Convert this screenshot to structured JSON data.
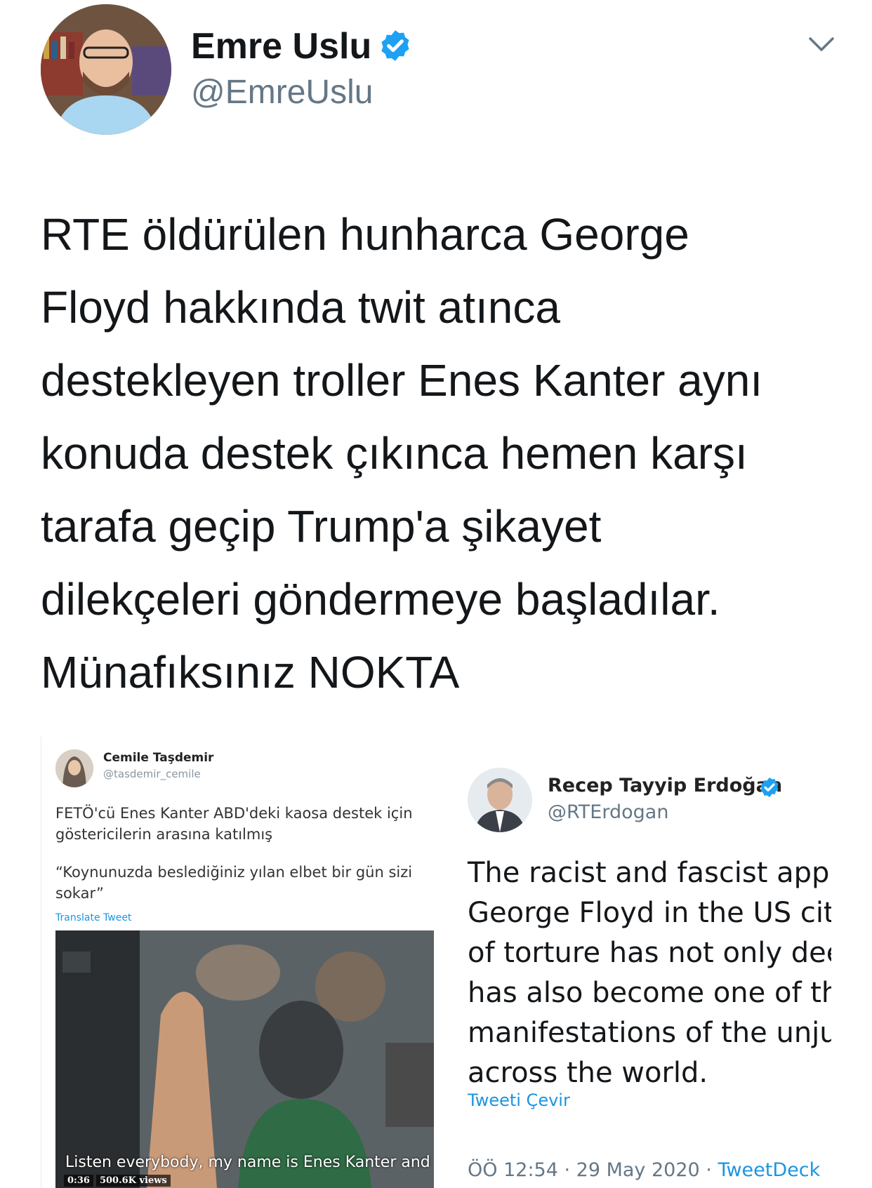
{
  "tweet": {
    "author_name": "Emre Uslu",
    "author_handle": "@EmreUslu",
    "verified_icon": "verified-badge-icon",
    "menu_icon": "chevron-down-icon",
    "text_lines": [
      "RTE öldürülen hunharca George",
      "Floyd hakkında twit atınca",
      "destekleyen troller Enes Kanter aynı",
      "konuda destek çıkınca hemen karşı",
      "tarafa geçip Trump'a şikayet",
      "dilekçeleri göndermeye başladılar.",
      "Münafıksınız NOKTA"
    ]
  },
  "media_left": {
    "author_name": "Cemile Taşdemir",
    "author_handle": "@tasdemir_cemile",
    "text_lines": [
      "FETÖ'cü Enes Kanter ABD'deki kaosa destek için",
      "göstericilerin arasına katılmış"
    ],
    "quote_lines": [
      "“Koynunuzda beslediğiniz yılan elbet bir gün sizi",
      "sokar”"
    ],
    "translate_label": "Translate Tweet",
    "video_caption": "Listen everybody, my name is Enes Kanter and I",
    "video_time": "0:36",
    "video_views": "500.6K views"
  },
  "media_right": {
    "author_name": "Recep Tayyip Erdoğan",
    "author_handle": "@RTErdogan",
    "verified_icon": "verified-badge-icon",
    "text_lines": [
      "The racist and fascist approach that killed",
      "George Floyd in the US city of Minneapolis",
      "of torture has not only deeply saddened us, but",
      "has also become one of the most painful",
      "manifestations of the unjust order we oppose",
      "across the world."
    ],
    "translate_label": "Tweeti Çevir",
    "timestamp": "ÖÖ 12:54 · 29 May 2020 · ",
    "source": "TweetDeck"
  },
  "colors": {
    "text": "#14171a",
    "secondary": "#657786",
    "link": "#1b95e0",
    "verified": "#1da1f2"
  }
}
